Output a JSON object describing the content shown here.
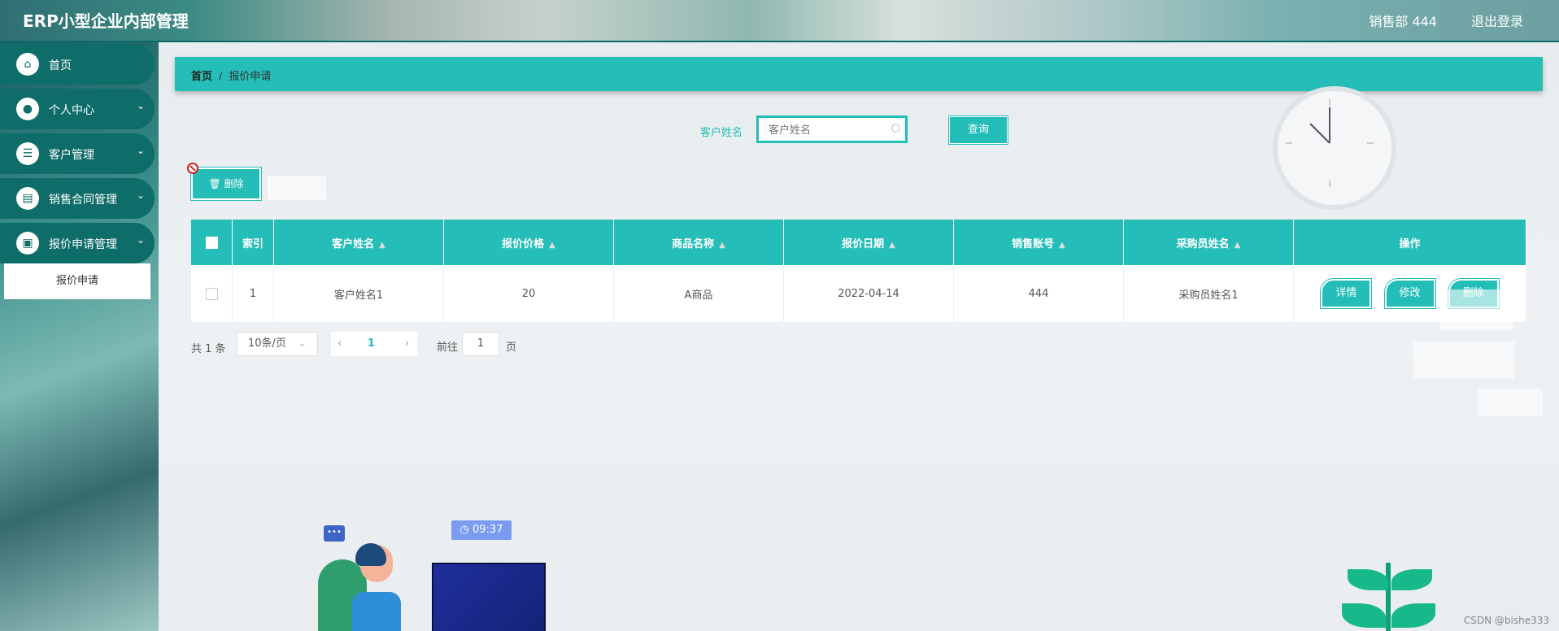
{
  "header": {
    "title": "ERP小型企业内部管理",
    "user": "销售部 444",
    "logout": "退出登录"
  },
  "sidebar": {
    "items": [
      {
        "label": "首页",
        "icon": "home-icon"
      },
      {
        "label": "个人中心",
        "icon": "user-icon"
      },
      {
        "label": "客户管理",
        "icon": "sliders-icon"
      },
      {
        "label": "销售合同管理",
        "icon": "clipboard-icon"
      },
      {
        "label": "报价申请管理",
        "icon": "clipboard-check-icon"
      }
    ],
    "submenu": "报价申请"
  },
  "breadcrumb": {
    "home": "首页",
    "separator": "/",
    "current": "报价申请"
  },
  "search": {
    "label": "客户姓名",
    "placeholder": "客户姓名",
    "button": "查询"
  },
  "toolbar": {
    "delete_label": "删除"
  },
  "table": {
    "headers": [
      "索引",
      "客户姓名",
      "报价价格",
      "商品名称",
      "报价日期",
      "销售账号",
      "采购员姓名",
      "操作"
    ],
    "rows": [
      {
        "index": "1",
        "customer": "客户姓名1",
        "price": "20",
        "product": "A商品",
        "date": "2022-04-14",
        "account": "444",
        "buyer": "采购员姓名1"
      }
    ],
    "actions": {
      "detail": "详情",
      "edit": "修改",
      "delete": "删除"
    }
  },
  "pagination": {
    "total": "共 1 条",
    "page_size": "10条/页",
    "current": "1",
    "goto_label": "前往",
    "goto_value": "1",
    "page_suffix": "页"
  },
  "decor": {
    "time": "09:37",
    "watermark": "CSDN @bishe333"
  },
  "colors": {
    "accent": "#24bdb7",
    "sidebar": "#0e6c69"
  }
}
